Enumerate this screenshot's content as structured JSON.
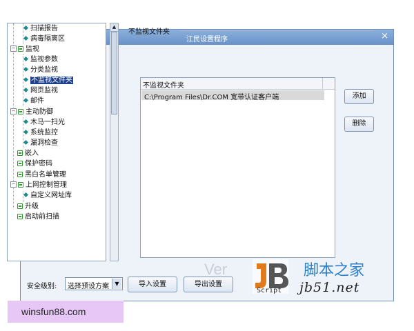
{
  "window": {
    "title": "江民设置程序"
  },
  "tree": {
    "items": [
      {
        "label": "扫描报告"
      },
      {
        "label": "病毒隔离区"
      },
      {
        "label": "监视"
      },
      {
        "label": "监视参数"
      },
      {
        "label": "分类监视"
      },
      {
        "label": "不监视文件夹"
      },
      {
        "label": "网页监视"
      },
      {
        "label": "邮件"
      },
      {
        "label": "主动防御"
      },
      {
        "label": "木马一扫光"
      },
      {
        "label": "系统监控"
      },
      {
        "label": "漏洞检查"
      },
      {
        "label": "嵌入"
      },
      {
        "label": "保护密码"
      },
      {
        "label": "黑白名单管理"
      },
      {
        "label": "上网控制管理"
      },
      {
        "label": "自定义网址库"
      },
      {
        "label": "升级"
      },
      {
        "label": "启动前扫描"
      }
    ],
    "expander_minus": "−"
  },
  "panel": {
    "section_title": "不监视文件夹",
    "list_header": "不监视文件夹",
    "rows": [
      "C:\\Program Files\\Dr.COM 宽带认证客户端"
    ]
  },
  "buttons": {
    "add": "添加",
    "delete": "删除",
    "import": "导入设置",
    "export": "导出设置"
  },
  "bottom": {
    "security_label": "安全级别:",
    "security_value": "选择预设方案"
  },
  "watermark": {
    "cn": "脚本之家",
    "url": "jb51.net",
    "script": "Script",
    "logo_text": "Ver"
  },
  "banner": {
    "text": "winsfun88.com"
  }
}
